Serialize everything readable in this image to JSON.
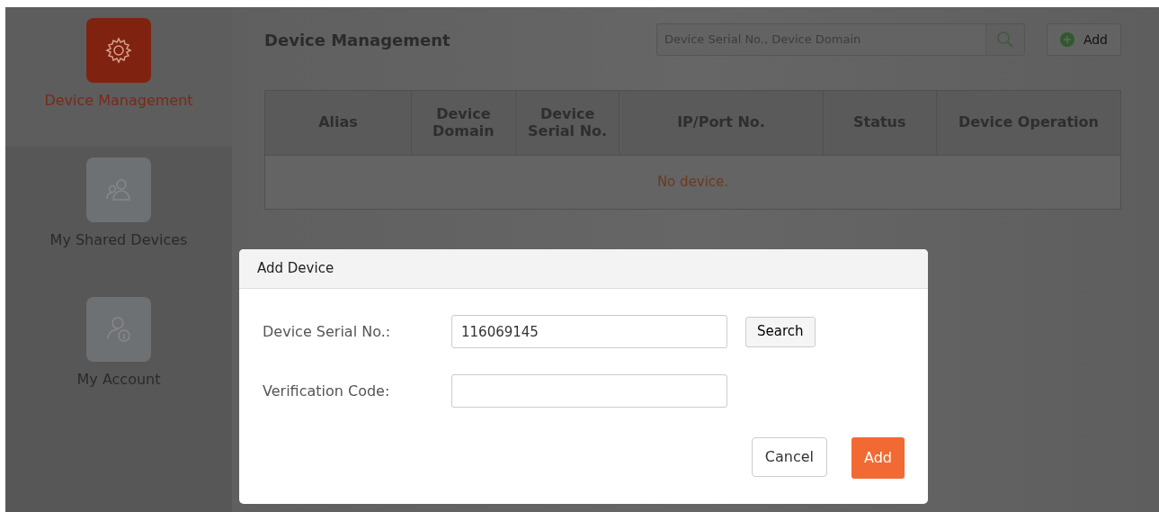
{
  "sidebar": {
    "items": [
      {
        "label": "Device Management",
        "kind": "gear",
        "selected": true
      },
      {
        "label": "My Shared Devices",
        "kind": "users",
        "selected": false
      },
      {
        "label": "My Account",
        "kind": "account",
        "selected": false
      }
    ]
  },
  "header": {
    "title": "Device Management",
    "search": {
      "placeholder": "Device Serial No., Device Domain"
    },
    "add_button": "Add"
  },
  "table": {
    "columns": [
      "Alias",
      "Device Domain",
      "Device Serial No.",
      "IP/Port No.",
      "Status",
      "Device Operation"
    ],
    "empty_message": "No device."
  },
  "dialog": {
    "title": "Add Device",
    "fields": [
      {
        "label": "Device Serial No.:",
        "value": "116069145",
        "search_label": "Search"
      },
      {
        "label": "Verification Code:"
      }
    ],
    "buttons": [
      {
        "label": "Cancel",
        "kind": "secondary"
      },
      {
        "label": "Add",
        "kind": "primary"
      }
    ]
  }
}
